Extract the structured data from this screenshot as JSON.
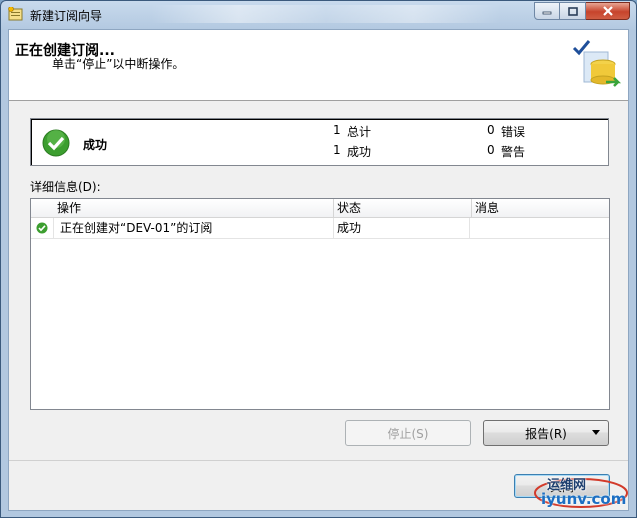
{
  "window": {
    "title": "新建订阅向导"
  },
  "header": {
    "title": "正在创建订阅...",
    "subtitle": "单击“停止”以中断操作。"
  },
  "summary": {
    "status": "成功",
    "total_count": "1",
    "total_label": "总计",
    "success_count": "1",
    "success_label": "成功",
    "error_count": "0",
    "error_label": "错误",
    "warning_count": "0",
    "warning_label": "警告"
  },
  "details": {
    "label": "详细信息(D):",
    "columns": [
      "操作",
      "状态",
      "消息"
    ],
    "rows": [
      {
        "action": "正在创建对“DEV-01”的订阅",
        "status": "成功",
        "message": "",
        "icon": "success-icon"
      }
    ]
  },
  "buttons": {
    "stop": "停止(S)",
    "report": "报告(R)",
    "close": "关闭"
  },
  "watermark": {
    "line1": "运维网",
    "line2": "iyunv.com"
  },
  "colors": {
    "success_green": "#3c9e2f",
    "title_bar": "#b9cde4",
    "close_button_red": "#c7442c"
  }
}
